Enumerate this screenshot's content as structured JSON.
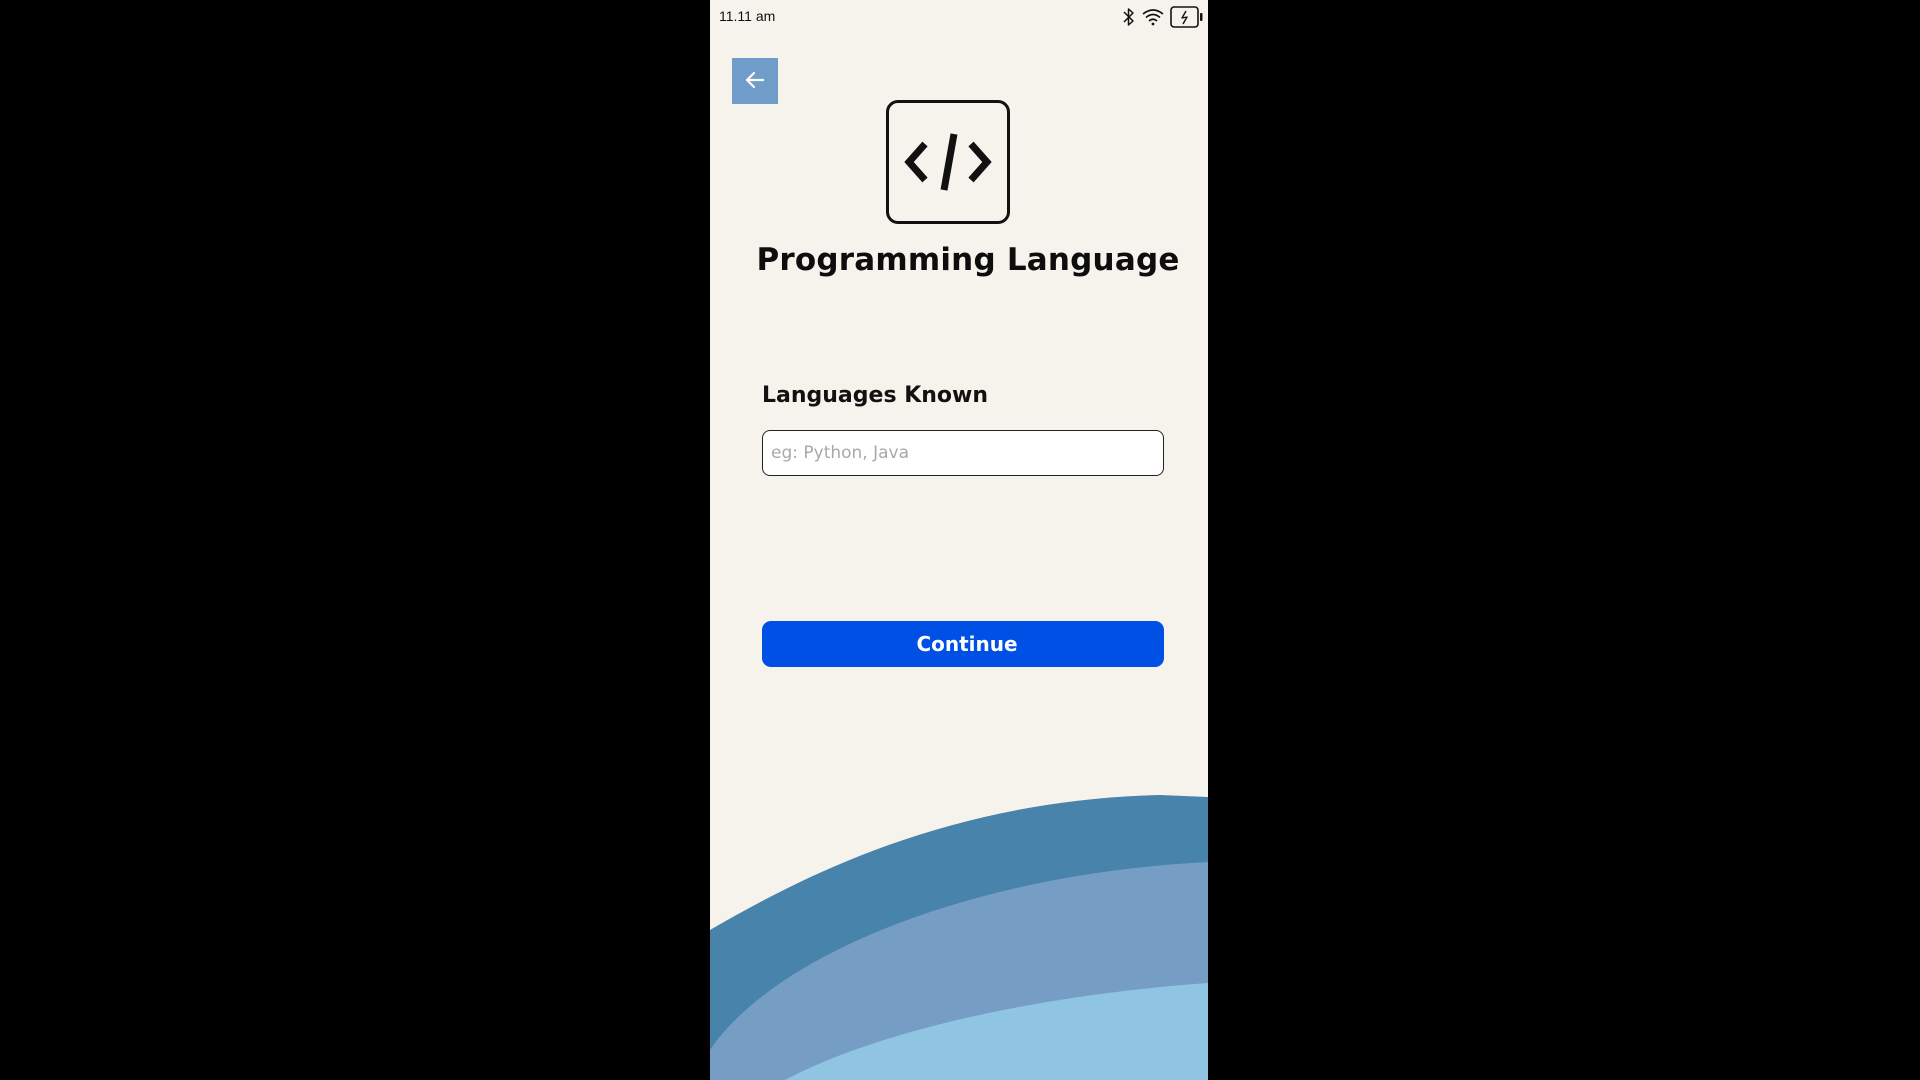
{
  "status_bar": {
    "time": "11.11 am",
    "icons": [
      "bluetooth-icon",
      "wifi-icon",
      "battery-charging-icon"
    ]
  },
  "header": {
    "back_icon": "arrow-left-icon",
    "logo_icon": "code-icon",
    "title": "Programming Language"
  },
  "form": {
    "label": "Languages Known",
    "input_value": "",
    "input_placeholder": "eg: Python, Java",
    "submit_label": "Continue"
  },
  "colors": {
    "background": "#f5f3ec",
    "back_button": "#6f9cc9",
    "primary_button": "#0050e6",
    "wave_dark": "#4783aa",
    "wave_mid": "#769dc4",
    "wave_light": "#8fc5e3"
  }
}
